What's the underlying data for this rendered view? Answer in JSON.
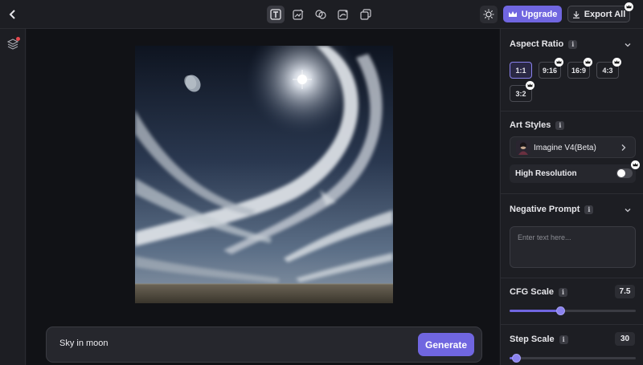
{
  "header": {
    "upgrade_label": "Upgrade",
    "export_label": "Export All",
    "tools": [
      "text-tool-icon",
      "image-edit-icon",
      "blend-icon",
      "sketch-icon",
      "gallery-icon"
    ]
  },
  "canvas": {
    "prompt_text": "Sky in moon",
    "generate_label": "Generate"
  },
  "panel": {
    "aspect_ratio": {
      "title": "Aspect Ratio",
      "options": [
        "1:1",
        "9:16",
        "16:9",
        "4:3",
        "3:2"
      ],
      "selected": "1:1"
    },
    "art_styles": {
      "title": "Art Styles",
      "selected_style": "Imagine V4(Beta)",
      "high_resolution_label": "High Resolution",
      "high_resolution_on": false
    },
    "negative_prompt": {
      "title": "Negative Prompt",
      "placeholder": "Enter text here..."
    },
    "cfg_scale": {
      "title": "CFG Scale",
      "value": "7.5",
      "fraction": 0.4
    },
    "step_scale": {
      "title": "Step Scale",
      "value": "30",
      "fraction": 0.05
    }
  },
  "colors": {
    "accent": "#7066e0",
    "background": "#16171b",
    "panel": "#1d1e23"
  }
}
